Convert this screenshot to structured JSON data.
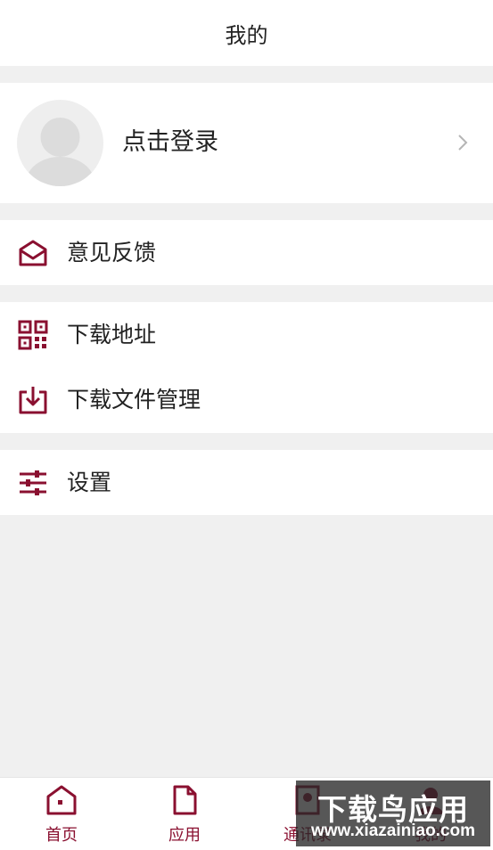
{
  "header": {
    "title": "我的"
  },
  "profile": {
    "login_label": "点击登录"
  },
  "menu": {
    "feedback": "意见反馈",
    "download_address": "下载地址",
    "download_manager": "下载文件管理",
    "settings": "设置"
  },
  "tabs": [
    {
      "label": "首页",
      "icon": "home-icon"
    },
    {
      "label": "应用",
      "icon": "document-icon"
    },
    {
      "label": "通讯录",
      "icon": "contacts-icon"
    },
    {
      "label": "我的",
      "icon": "user-icon"
    }
  ],
  "watermark": {
    "line1": "下载鸟应用",
    "line2": "www.xiazainiao.com"
  },
  "colors": {
    "accent": "#8a1030",
    "background": "#f0f0f0",
    "text": "#222222"
  }
}
